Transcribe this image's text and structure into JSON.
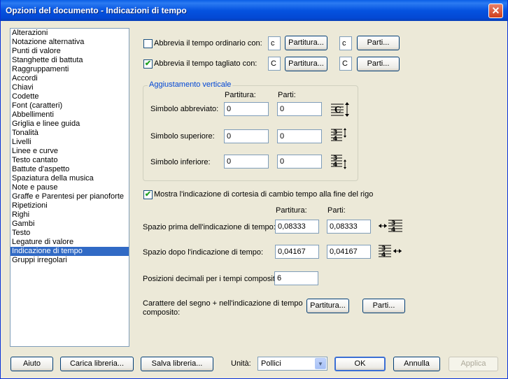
{
  "window": {
    "title": "Opzioni del documento - Indicazioni di tempo",
    "close_glyph": "✕"
  },
  "sidebar": {
    "items": [
      "Alterazioni",
      "Notazione alternativa",
      "Punti di valore",
      "Stanghette di battuta",
      "Raggruppamenti",
      "Accordi",
      "Chiavi",
      "Codette",
      "Font (caratteri)",
      "Abbellimenti",
      "Griglia e linee guida",
      "Tonalità",
      "Livelli",
      "Linee e curve",
      "Testo cantato",
      "Battute d'aspetto",
      "Spaziatura della musica",
      "Note e pause",
      "Graffe e Parentesi per pianoforte",
      "Ripetizioni",
      "Righi",
      "Gambi",
      "Testo",
      "Legature di valore",
      "Indicazione di tempo",
      "Gruppi irregolari"
    ],
    "selected_index": 24
  },
  "abbrev": {
    "common": {
      "label": "Abbrevia il tempo ordinario con:",
      "checked": false,
      "score_value": "c",
      "parts_value": "c"
    },
    "cut": {
      "label": "Abbrevia il tempo tagliato con:",
      "checked": true,
      "score_value": "C",
      "parts_value": "C"
    },
    "score_button": "Partitura...",
    "parts_button": "Parti..."
  },
  "vertical": {
    "group_title": "Aggiustamento verticale",
    "col_score": "Partitura:",
    "col_parts": "Parti:",
    "rows": [
      {
        "label": "Simbolo abbreviato:",
        "score": "0",
        "parts": "0"
      },
      {
        "label": "Simbolo superiore:",
        "score": "0",
        "parts": "0"
      },
      {
        "label": "Simbolo inferiore:",
        "score": "0",
        "parts": "0"
      }
    ]
  },
  "courtesy": {
    "label": "Mostra l'indicazione di cortesia di cambio tempo alla fine del rigo",
    "checked": true
  },
  "spacing": {
    "col_score": "Partitura:",
    "col_parts": "Parti:",
    "before": {
      "label": "Spazio prima dell'indicazione di tempo:",
      "score": "0,08333",
      "parts": "0,08333"
    },
    "after": {
      "label": "Spazio dopo l'indicazione di tempo:",
      "score": "0,04167",
      "parts": "0,04167"
    }
  },
  "decimals": {
    "label": "Posizioni decimali per i tempi compositi:",
    "value": "6"
  },
  "plus_char": {
    "label_line1": "Carattere del segno + nell'indicazione di tempo",
    "label_line2": "composito:",
    "score_button": "Partitura...",
    "parts_button": "Parti..."
  },
  "footer": {
    "help": "Aiuto",
    "load_library": "Carica libreria...",
    "save_library": "Salva libreria...",
    "units_label": "Unità:",
    "units_value": "Pollici",
    "ok": "OK",
    "cancel": "Annulla",
    "apply": "Applica"
  }
}
